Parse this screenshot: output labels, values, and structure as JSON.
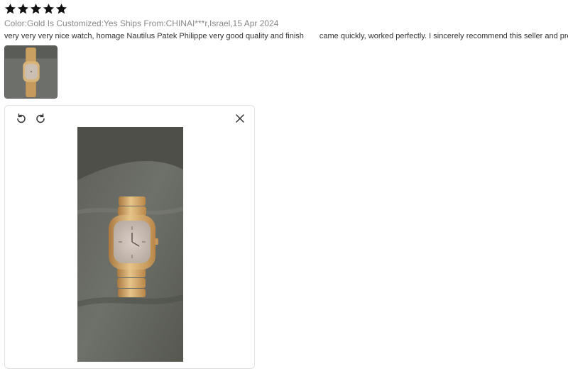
{
  "review": {
    "rating": 5,
    "max_rating": 5,
    "star_color": "#111111",
    "meta": "Color:Gold Is Customized:Yes Ships From:CHINAI***r,Israel,15 Apr 2024",
    "text_part1": "very very very nice watch, homage Nautilus Patek Philippe very good quality and finish",
    "text_part2": "came quickly, worked perfectly. I sincerely recommend this seller and product"
  },
  "viewer": {
    "rotate_left_icon": "rotate-left-icon",
    "rotate_right_icon": "rotate-right-icon",
    "close_icon": "close-icon"
  }
}
